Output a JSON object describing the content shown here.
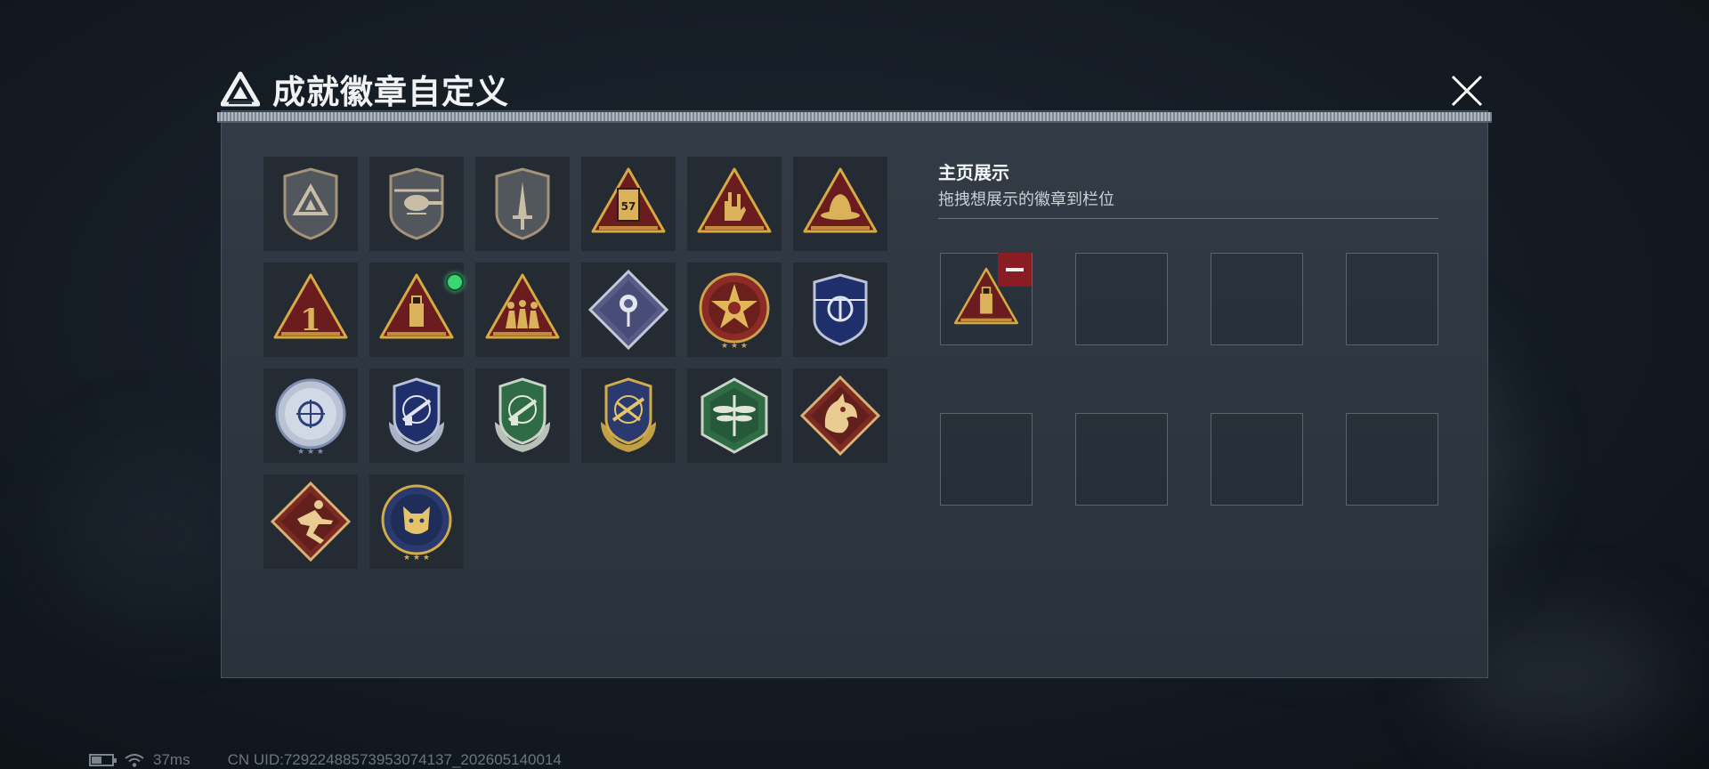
{
  "header": {
    "title": "成就徽章自定义",
    "logo_icon": "triangle-logo-icon"
  },
  "close_button": {
    "icon": "close-x-icon"
  },
  "badges": [
    {
      "name": "triangle-emblem",
      "shape": "shield",
      "style": "slate"
    },
    {
      "name": "helicopter",
      "shape": "shield",
      "style": "slate"
    },
    {
      "name": "dagger",
      "shape": "shield",
      "style": "slate"
    },
    {
      "name": "numbered-plate",
      "shape": "triangle",
      "style": "red-gold",
      "glyph": "57"
    },
    {
      "name": "rock-hand",
      "shape": "triangle",
      "style": "red-gold"
    },
    {
      "name": "hat",
      "shape": "triangle",
      "style": "red-gold"
    },
    {
      "name": "number-one",
      "shape": "triangle",
      "style": "red-gold",
      "glyph": "1"
    },
    {
      "name": "usb-drive",
      "shape": "triangle",
      "style": "red-gold",
      "is_new": true
    },
    {
      "name": "soldiers",
      "shape": "triangle",
      "style": "red-gold"
    },
    {
      "name": "rose",
      "shape": "diamond",
      "style": "steel-blue"
    },
    {
      "name": "star-emblem",
      "shape": "circle",
      "style": "red-star"
    },
    {
      "name": "police-shield",
      "shape": "shield",
      "style": "navy"
    },
    {
      "name": "crosshair-circle",
      "shape": "circle",
      "style": "silver-blue"
    },
    {
      "name": "rifle-navy",
      "shape": "crest",
      "style": "navy"
    },
    {
      "name": "rifle-green",
      "shape": "crest",
      "style": "green"
    },
    {
      "name": "sniper-gold",
      "shape": "crest",
      "style": "navy-gold"
    },
    {
      "name": "dragonfly",
      "shape": "hexagon",
      "style": "green"
    },
    {
      "name": "dragon",
      "shape": "diamond",
      "style": "red"
    },
    {
      "name": "runner",
      "shape": "diamond",
      "style": "red"
    },
    {
      "name": "wildcat",
      "shape": "circle",
      "style": "navy-gold"
    }
  ],
  "showcase": {
    "title": "主页展示",
    "subtitle": "拖拽想展示的徽章到栏位",
    "slots": [
      "usb-drive",
      "",
      "",
      "",
      "",
      "",
      "",
      ""
    ],
    "remove_icon": "minus-icon"
  },
  "status_bar": {
    "battery_icon": "battery-icon",
    "wifi_icon": "wifi-icon",
    "ping": "37ms",
    "uid": "CN UID:7292248857395307413‍7_202605140014"
  },
  "colors": {
    "panel_bg": "#2f3741",
    "tile_bg": "#242b33",
    "accent_red": "#8a1d24",
    "gold": "#c9a24a",
    "new_dot": "#3ad671"
  }
}
